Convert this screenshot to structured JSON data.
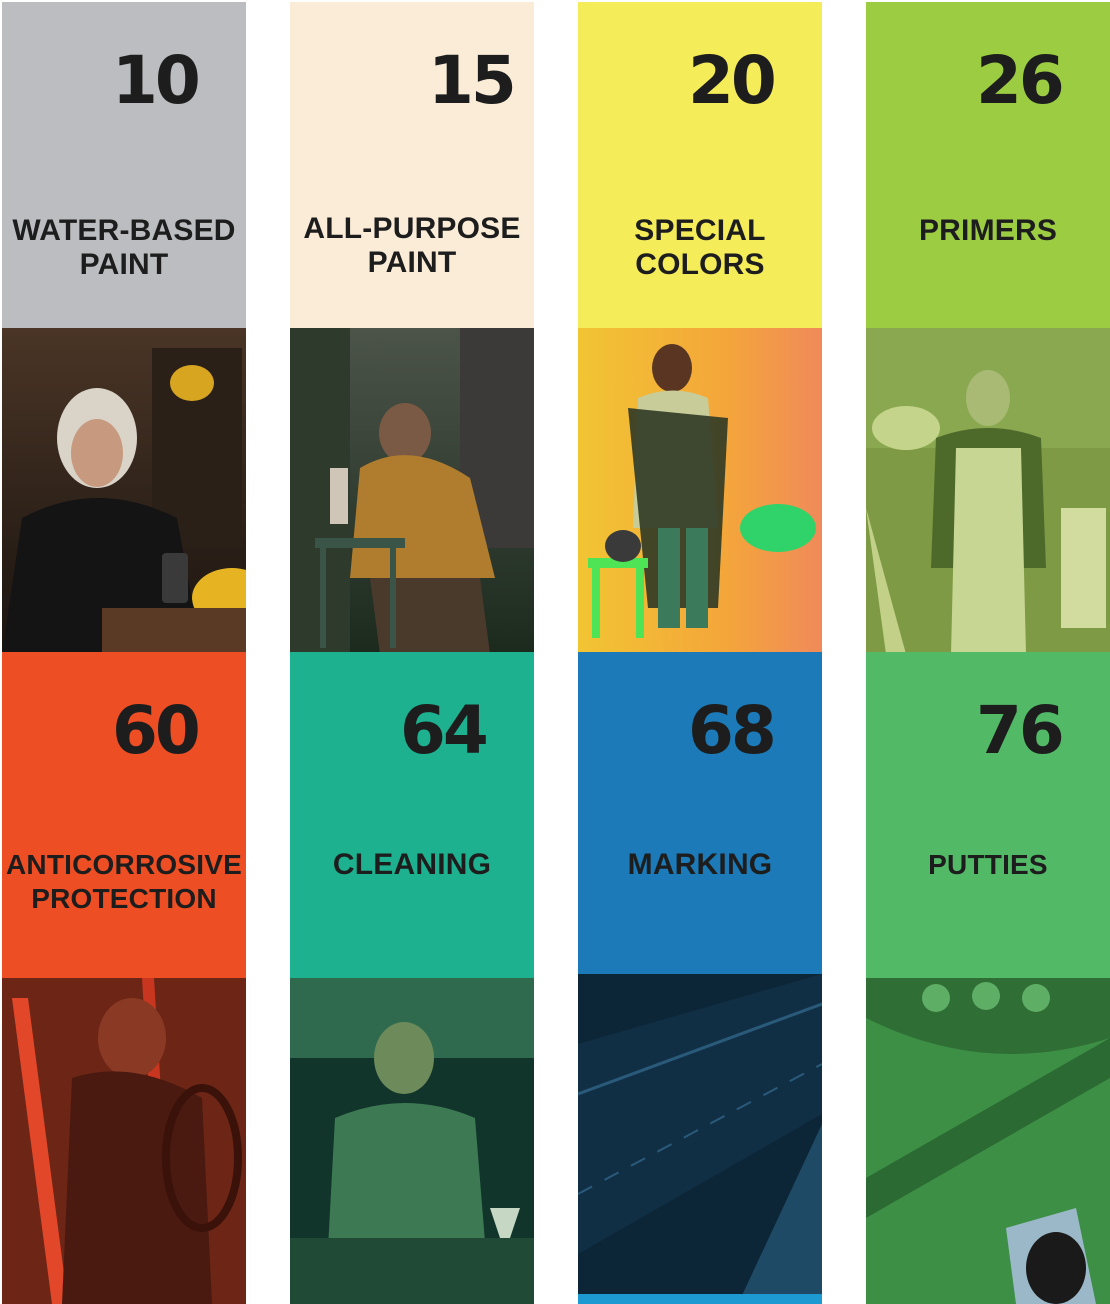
{
  "catalog": {
    "cards": [
      {
        "page": "10",
        "label_line1": "WATER-BASED",
        "label_line2": "PAINT",
        "color": "#bcbdc0",
        "photo_tint": "#3a2d24"
      },
      {
        "page": "15",
        "label_line1": "ALL-PURPOSE",
        "label_line2": "PAINT",
        "color": "#fbecd7",
        "photo_tint": "#2b3a2d"
      },
      {
        "page": "20",
        "label_line1": "SPECIAL",
        "label_line2": "COLORS",
        "color": "#f4ec59",
        "photo_tint": "#f0b43a"
      },
      {
        "page": "26",
        "label_line1": "PRIMERS",
        "label_line2": "",
        "color": "#9ccc42",
        "photo_tint": "#6f8d3a"
      },
      {
        "page": "60",
        "label_line1": "ANTICORROSIVE",
        "label_line2": "PROTECTION",
        "color": "#ee4e23",
        "photo_tint": "#6b2416"
      },
      {
        "page": "64",
        "label_line1": "CLEANING",
        "label_line2": "",
        "color": "#1db18f",
        "photo_tint": "#174a38"
      },
      {
        "page": "68",
        "label_line1": "MARKING",
        "label_line2": "",
        "color": "#1b7ab7",
        "photo_tint": "#0c2a3e"
      },
      {
        "page": "76",
        "label_line1": "PUTTIES",
        "label_line2": "",
        "color": "#52b967",
        "photo_tint": "#2c7a3a"
      }
    ]
  }
}
